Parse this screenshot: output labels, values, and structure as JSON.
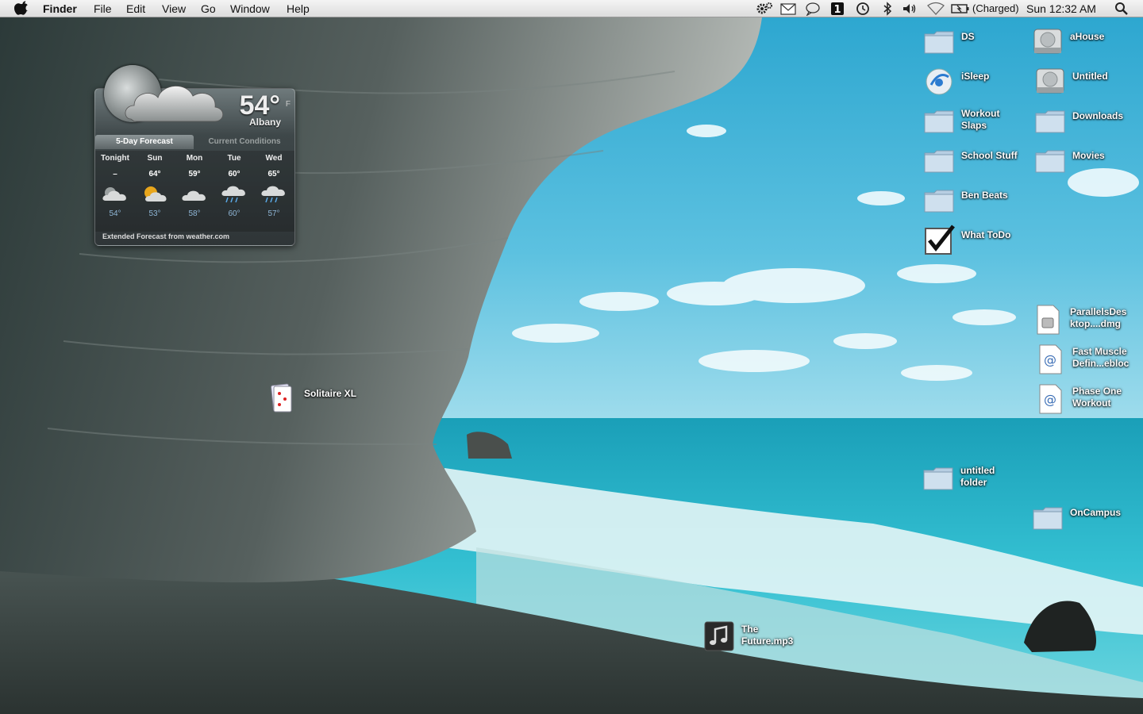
{
  "menubar": {
    "app_name": "Finder",
    "menus": [
      "File",
      "Edit",
      "View",
      "Go",
      "Window",
      "Help"
    ],
    "battery_status": "(Charged)",
    "clock": "Sun 12:32 AM",
    "status_icons": [
      "gear-icon",
      "mail-icon",
      "chat-bubble-icon",
      "dashboard-icon",
      "time-machine-icon",
      "bluetooth-icon",
      "volume-icon",
      "wifi-icon",
      "battery-icon",
      "spotlight-icon"
    ]
  },
  "weather": {
    "temperature": "54°",
    "unit": "F",
    "city": "Albany",
    "tab_forecast": "5-Day Forecast",
    "tab_conditions": "Current Conditions",
    "days": [
      {
        "name": "Tonight",
        "high": "–",
        "low": "54°",
        "icon": "cloudy-night-icon"
      },
      {
        "name": "Sun",
        "high": "64°",
        "low": "53°",
        "icon": "partly-sunny-icon"
      },
      {
        "name": "Mon",
        "high": "59°",
        "low": "58°",
        "icon": "cloudy-icon"
      },
      {
        "name": "Tue",
        "high": "60°",
        "low": "60°",
        "icon": "rain-icon"
      },
      {
        "name": "Wed",
        "high": "65°",
        "low": "57°",
        "icon": "rain-icon"
      }
    ],
    "extended": "Extended Forecast from weather.com"
  },
  "desktop": {
    "ds": "DS",
    "ahouse": "aHouse",
    "isleep": "iSleep",
    "untitled_disk": "Untitled",
    "workout1": "Workout",
    "workout2": "Slaps",
    "downloads": "Downloads",
    "school": "School Stuff",
    "movies": "Movies",
    "ben": "Ben Beats",
    "todo": "What ToDo",
    "parallels1": "ParallelsDes",
    "parallels2": "ktop....dmg",
    "muscle1": "Fast Muscle",
    "muscle2": "Defin...ebloc",
    "phase1": "Phase One",
    "phase2": "Workout",
    "untfolder1": "untitled",
    "untfolder2": "folder",
    "oncampus": "OnCampus",
    "solitaire": "Solitaire XL",
    "mp3_1": "The",
    "mp3_2": "Future.mp3"
  }
}
